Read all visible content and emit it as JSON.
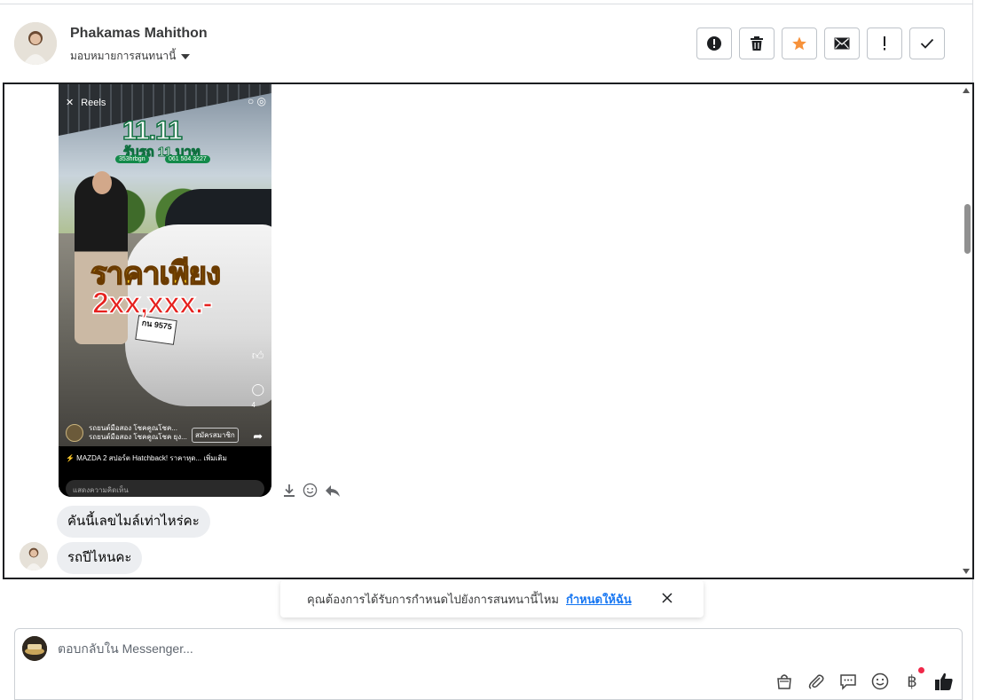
{
  "header": {
    "contact_name": "Phakamas Mahithon",
    "assign_label": "มอบหมายการสนทนานี้",
    "toolbar": [
      {
        "name": "mark-spam-button",
        "icon": "alert-circle-icon"
      },
      {
        "name": "delete-button",
        "icon": "trash-icon"
      },
      {
        "name": "star-button",
        "icon": "star-icon",
        "color": "#f7923b"
      },
      {
        "name": "mark-unread-button",
        "icon": "envelope-icon"
      },
      {
        "name": "follow-up-button",
        "icon": "exclamation-icon"
      },
      {
        "name": "mark-done-button",
        "icon": "check-icon"
      }
    ]
  },
  "reel": {
    "top_label": "Reels",
    "promo_title": "11.11",
    "promo_subtitle": "รับรถ 11 บาท",
    "promo_pill_1": "353hrbgn",
    "promo_pill_2": "061 504 3227",
    "price_label": "ราคาเพียง",
    "price_value": "2xx,xxx.-",
    "plate": "กน 9575",
    "comment_count": "4",
    "page_name": "รถยนต์มือสอง โชคคูณโชค...",
    "page_sub": "รถยนต์มือสอง โชคคูณโชค ยุง...",
    "subscribe_label": "สมัครสมาชิก",
    "caption": "⚡ MAZDA 2 สปอร์ต Hatchback! ราคาหุด... เพิ่มเติม",
    "comment_placeholder": "แสดงความคิดเห็น"
  },
  "messages": [
    {
      "text": "คันนี้เลขไมล์เท่าไหร่คะ"
    },
    {
      "text": "รถปีไหนคะ"
    }
  ],
  "banner": {
    "text": "คุณต้องการได้รับการกำหนดไปยังการสนทนานี้ไหม",
    "link": "กำหนดให้ฉัน"
  },
  "composer": {
    "placeholder": "ตอบกลับใน Messenger...",
    "tools": [
      "shopping-bag-icon",
      "paperclip-icon",
      "saved-replies-icon",
      "emoji-icon",
      "baht-icon",
      "like-icon"
    ],
    "baht_symbol": "฿",
    "notification_color": "#f02849",
    "like_color": "#1c1e21"
  }
}
